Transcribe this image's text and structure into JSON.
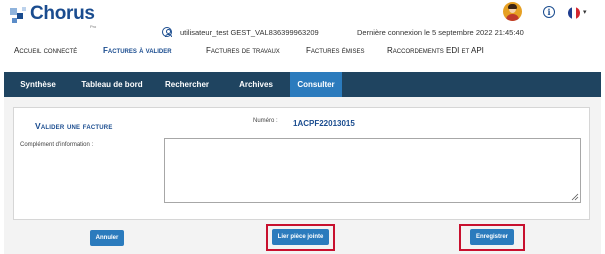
{
  "header": {
    "logo_text": "Chorus",
    "logo_sub": "Pro",
    "user_name": "utilisateur_test GEST_VAL836399963209",
    "last_login": "Dernière connexion le 5 septembre 2022 21:45:40",
    "info_icon": "info-icon",
    "language_flag": "french-flag-icon"
  },
  "main_nav": {
    "items": [
      {
        "label": "Accueil connecté"
      },
      {
        "label": "Factures à valider"
      },
      {
        "label": "Factures de travaux"
      },
      {
        "label": "Factures émises"
      },
      {
        "label": "Raccordements EDI et API"
      }
    ],
    "active_index": 1
  },
  "sub_nav": {
    "tabs": [
      {
        "label": "Synthèse"
      },
      {
        "label": "Tableau de bord"
      },
      {
        "label": "Rechercher"
      },
      {
        "label": "Archives"
      },
      {
        "label": "Consulter"
      }
    ],
    "active_index": 4
  },
  "form": {
    "title": "Valider une facture",
    "numero_label": "Numéro :",
    "numero_value": "1ACPF22013015",
    "complement_label": "Complément d'information :",
    "complement_value": ""
  },
  "buttons": {
    "cancel": "Annuler",
    "attach": "Lier pièce jointe",
    "save": "Enregistrer"
  },
  "colors": {
    "brand": "#1a4c8f",
    "subnav_bg": "#1f4460",
    "button": "#2b7bbd",
    "highlight": "#c8102e"
  }
}
